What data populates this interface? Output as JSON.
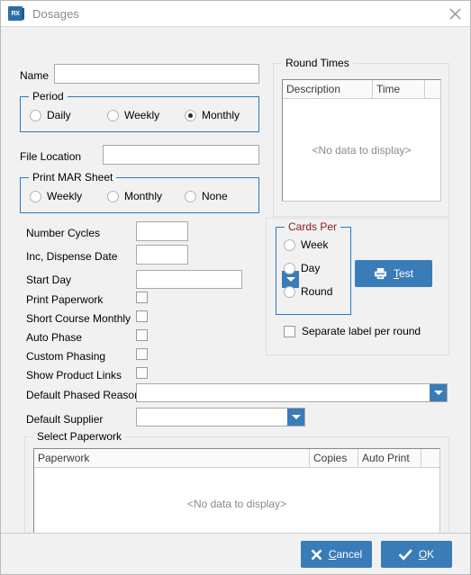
{
  "window": {
    "title": "Dosages",
    "app_icon": "rx-icon",
    "app_icon_text": "RX",
    "close_icon": "close-icon",
    "accent_color": "#3a7cb8",
    "group_border_color": "#2a7ac0",
    "cards_per_caption_color": "#8b1a1a"
  },
  "form": {
    "name_label": "Name",
    "name_value": "",
    "name_placeholder": "",
    "file_location_label": "File Location",
    "file_location_value": "",
    "file_location_placeholder": "",
    "number_cycles_label": "Number Cycles",
    "number_cycles_value": "",
    "inc_dispense_date_label": "Inc, Dispense Date",
    "inc_dispense_date_value": "",
    "start_day_label": "Start Day",
    "start_day_value": "",
    "default_phased_reason_label": "Default Phased Reason",
    "default_phased_reason_value": "",
    "default_supplier_label": "Default Supplier",
    "default_supplier_value": ""
  },
  "period_group": {
    "caption": "Period",
    "options": [
      {
        "label": "Daily",
        "selected": false
      },
      {
        "label": "Weekly",
        "selected": false
      },
      {
        "label": "Monthly",
        "selected": true
      }
    ]
  },
  "print_mar_group": {
    "caption": "Print MAR Sheet",
    "options": [
      {
        "label": "Weekly",
        "selected": false
      },
      {
        "label": "Monthly",
        "selected": false
      },
      {
        "label": "None",
        "selected": false
      }
    ]
  },
  "checkboxes": [
    {
      "label": "Print Paperwork",
      "checked": false
    },
    {
      "label": "Short Course Monthly",
      "checked": false
    },
    {
      "label": "Auto Phase",
      "checked": false
    },
    {
      "label": "Custom Phasing",
      "checked": false
    },
    {
      "label": "Show Product Links",
      "checked": false
    }
  ],
  "round_times": {
    "caption": "Round Times",
    "columns": [
      "Description",
      "Time"
    ],
    "rows": [],
    "empty_text": "<No data to display>"
  },
  "cards_per": {
    "caption": "Cards Per",
    "options": [
      {
        "label": "Week",
        "selected": false
      },
      {
        "label": "Day",
        "selected": false
      },
      {
        "label": "Round",
        "selected": false
      }
    ],
    "separate_label_per_round": {
      "label": "Separate label per round",
      "checked": false
    },
    "test_button": {
      "label": "Test",
      "accel": "T",
      "icon": "printer-icon"
    }
  },
  "select_paperwork": {
    "caption": "Select Paperwork",
    "columns": [
      "Paperwork",
      "Copies",
      "Auto Print"
    ],
    "rows": [],
    "empty_text": "<No data to display>"
  },
  "footer": {
    "cancel_button": {
      "label": "Cancel",
      "accel": "C",
      "icon": "x-icon"
    },
    "ok_button": {
      "label": "OK",
      "accel": "O",
      "icon": "check-icon"
    }
  }
}
